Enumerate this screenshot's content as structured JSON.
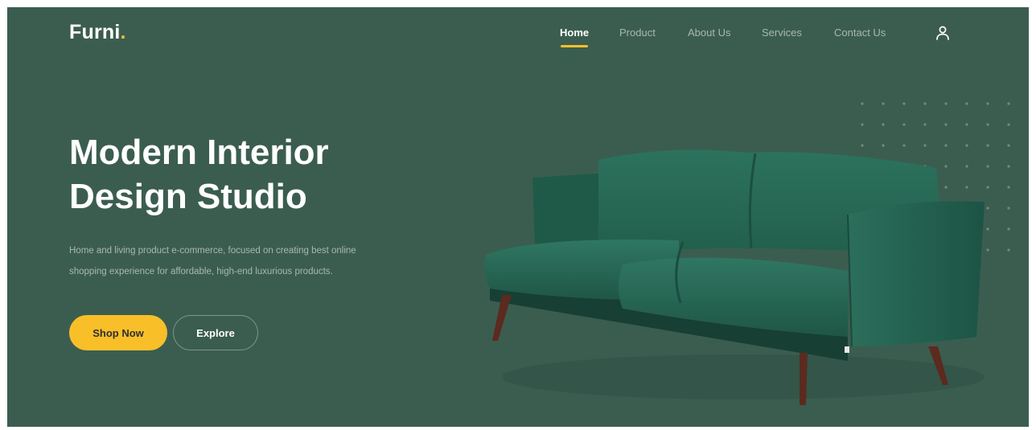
{
  "brand": {
    "name": "Furni",
    "dot": "."
  },
  "nav": {
    "items": [
      {
        "label": "Home",
        "active": true
      },
      {
        "label": "Product",
        "active": false
      },
      {
        "label": "About Us",
        "active": false
      },
      {
        "label": "Services",
        "active": false
      },
      {
        "label": "Contact Us",
        "active": false
      }
    ],
    "user_icon": "user-icon"
  },
  "hero": {
    "title_line1": "Modern Interior",
    "title_line2": "Design Studio",
    "description": "Home and living product e-commerce, focused on creating best online shopping experience for affordable, high-end luxurious products.",
    "primary_button": "Shop Now",
    "secondary_button": "Explore"
  },
  "colors": {
    "background": "#3b5d50",
    "accent": "#f9bf29",
    "sofa": "#2a6b58"
  }
}
